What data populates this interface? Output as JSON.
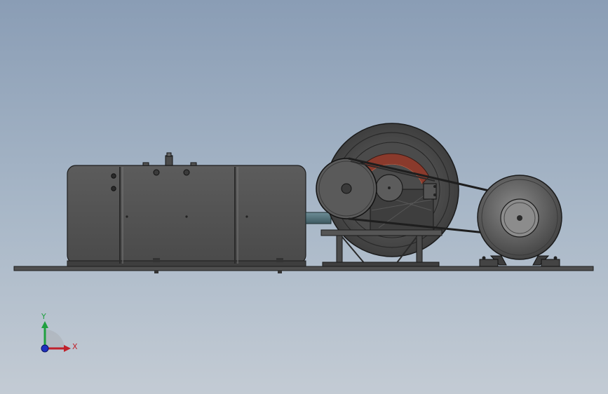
{
  "viewport": {
    "background_top": "#8a9db5",
    "background_bottom": "#c3cbd4",
    "model_color": "#5a5a5a",
    "edge_color": "#222222",
    "accent_red": "#8a3a2c"
  },
  "triad": {
    "x_label": "X",
    "y_label": "Y",
    "x_color": "#c0202a",
    "y_color": "#20a040",
    "z_color": "#2030c0"
  }
}
